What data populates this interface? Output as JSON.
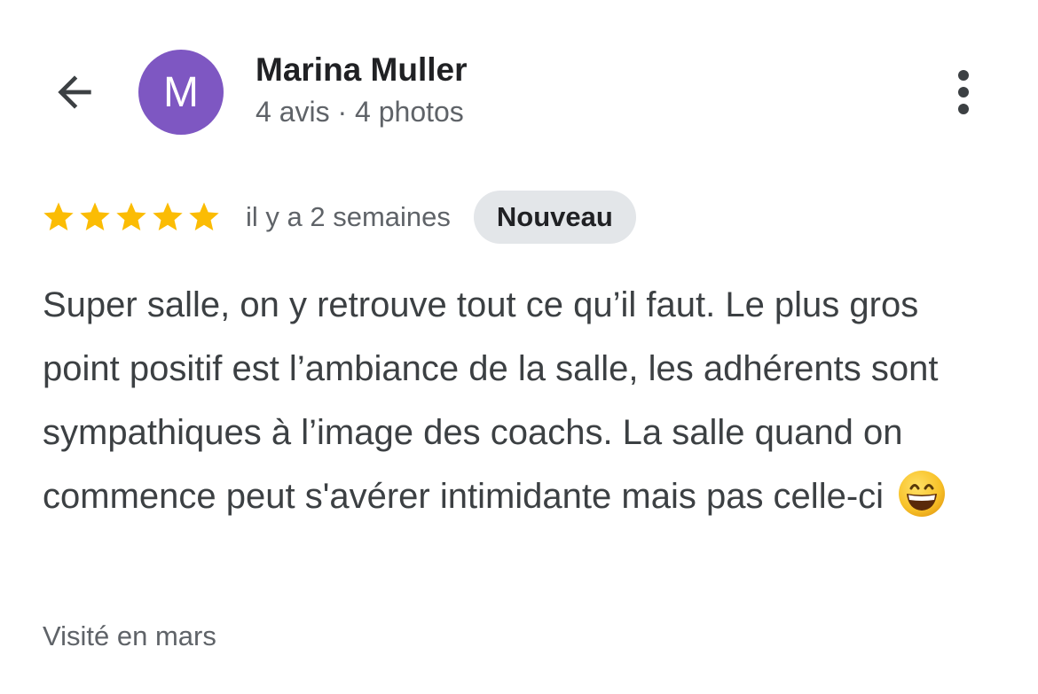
{
  "header": {
    "avatar_letter": "M",
    "avatar_color": "#7e57c2",
    "author_name": "Marina Muller",
    "author_meta": "4 avis · 4 photos",
    "back_icon": "arrow-back-icon",
    "menu_icon": "more-vert-icon"
  },
  "review": {
    "rating": 5,
    "rating_max": 5,
    "star_color": "#fbbc04",
    "time_ago": "il y a 2 semaines",
    "badge": "Nouveau",
    "text": "Super salle, on y retrouve tout ce qu’il faut. Le plus gros point positif est l’ambiance de la salle, les adhérents sont sympathiques à l’image des coachs. La salle quand on commence peut s'avérer intimidante mais pas celle-ci",
    "emoji_icon": "grinning-face-emoji",
    "visit": "Visité en mars"
  }
}
